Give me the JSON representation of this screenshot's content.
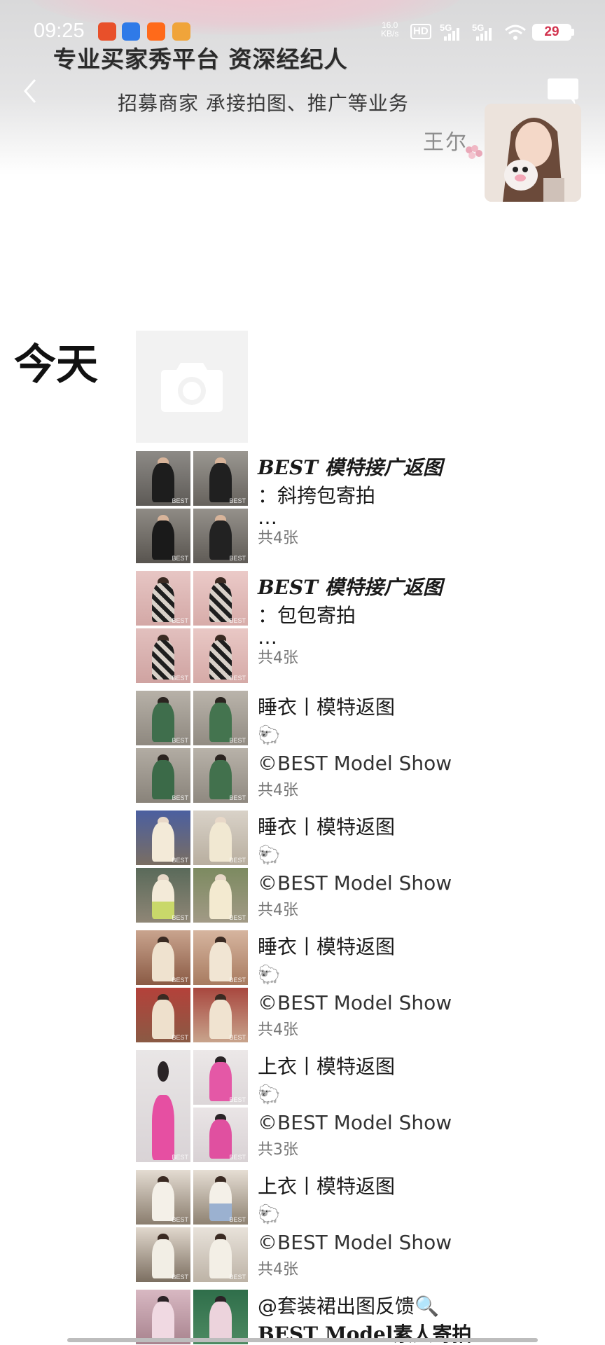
{
  "status_bar": {
    "time": "09:25",
    "net_speed": "16.0",
    "net_unit": "KB/s",
    "hd": "HD",
    "signal_1": "5G",
    "signal_2": "5G",
    "battery": "29"
  },
  "cover": {
    "headline": "专业买家秀平台 资深经纪人",
    "subline": "招募商家 承接拍图、推广等业务",
    "name": "王尔"
  },
  "icons": {
    "back": "chevron-left-icon",
    "messages": "message-bubble-icon",
    "camera": "camera-icon"
  },
  "timeline": {
    "date_label": "今天",
    "posts": [
      {
        "lines": [
          "BEST 模特接广返图",
          "：斜挎包寄拍",
          "…"
        ],
        "count": "共4张"
      },
      {
        "lines": [
          "BEST 模特接广返图",
          "：包包寄拍",
          "…"
        ],
        "count": "共4张"
      },
      {
        "lines": [
          "睡衣丨模特返图",
          "🐑",
          "©BEST Model Show"
        ],
        "count": "共4张"
      },
      {
        "lines": [
          "睡衣丨模特返图",
          "🐑",
          "©BEST Model Show"
        ],
        "count": "共4张"
      },
      {
        "lines": [
          "睡衣丨模特返图",
          "🐑",
          "©BEST Model Show"
        ],
        "count": "共4张"
      },
      {
        "lines": [
          "上衣丨模特返图",
          "🐑",
          "©BEST Model Show"
        ],
        "count": "共3张"
      },
      {
        "lines": [
          "上衣丨模特返图",
          "🐑",
          "©BEST Model Show"
        ],
        "count": "共4张"
      },
      {
        "lines": [
          "@套装裙出图反馈🔍",
          "BEST Model素人寄拍"
        ],
        "count": ""
      }
    ],
    "watermark": "BEST"
  },
  "colors": {
    "accent_pink": "#d2334e",
    "count_gray": "#777777"
  }
}
